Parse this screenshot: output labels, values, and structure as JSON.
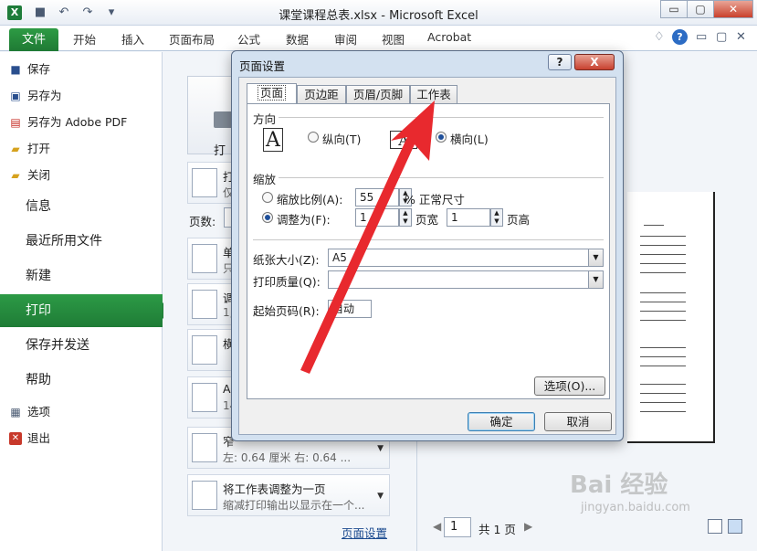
{
  "window": {
    "title": "课堂课程总表.xlsx - Microsoft Excel",
    "app_icon": "X",
    "minimize": "▭",
    "restore": "▢",
    "close": "✕"
  },
  "ribbon": {
    "file_tab": "文件",
    "tabs": [
      "开始",
      "插入",
      "页面布局",
      "公式",
      "数据",
      "审阅",
      "视图",
      "Acrobat"
    ],
    "help": "?"
  },
  "sidebar": {
    "small_items": [
      {
        "label": "保存",
        "icon": "save-icon"
      },
      {
        "label": "另存为",
        "icon": "save-as-icon"
      },
      {
        "label": "另存为 Adobe PDF",
        "icon": "pdf-icon"
      },
      {
        "label": "打开",
        "icon": "open-folder-icon"
      },
      {
        "label": "关闭",
        "icon": "close-folder-icon"
      }
    ],
    "big_items": [
      "信息",
      "最近所用文件",
      "新建",
      "打印",
      "保存并发送",
      "帮助"
    ],
    "bottom_items": [
      {
        "label": "选项",
        "icon": "options-icon"
      },
      {
        "label": "退出",
        "icon": "exit-icon"
      }
    ],
    "active": "打印"
  },
  "print_panel": {
    "print_button": "打印",
    "pages_label": "页数:",
    "options": [
      {
        "t1": "打",
        "t2": "仅"
      },
      {
        "t1": "单",
        "t2": "只"
      },
      {
        "t1": "调",
        "t2": "1,"
      },
      {
        "t1": "横",
        "t2": ""
      },
      {
        "t1": "A",
        "t2": "14"
      },
      {
        "t1": "窄",
        "t2": "左: 0.64 厘米    右: 0.64 ..."
      },
      {
        "t1": "将工作表调整为一页",
        "t2": "缩减打印输出以显示在一个..."
      }
    ],
    "page_setup_link": "页面设置"
  },
  "preview": {
    "current_page": "1",
    "total": "共 1 页",
    "watermark": "Bai 经验",
    "watermark_url": "jingyan.baidu.com"
  },
  "dialog": {
    "title": "页面设置",
    "help": "?",
    "close": "X",
    "tabs": [
      "页面",
      "页边距",
      "页眉/页脚",
      "工作表"
    ],
    "active_tab": "页面",
    "orientation": {
      "section": "方向",
      "portrait": "纵向(T)",
      "landscape": "横向(L)",
      "selected": "landscape"
    },
    "scaling": {
      "section": "缩放",
      "adjust_label": "缩放比例(A):",
      "adjust_value": "55",
      "adjust_unit": "% 正常尺寸",
      "fit_label": "调整为(F):",
      "fit_wide": "1",
      "fit_wide_unit": "页宽",
      "fit_tall": "1",
      "fit_tall_unit": "页高",
      "selected": "fit"
    },
    "paper_size_label": "纸张大小(Z):",
    "paper_size_value": "A5",
    "print_quality_label": "打印质量(Q):",
    "print_quality_value": "",
    "first_page_label": "起始页码(R):",
    "first_page_value": "自动",
    "options_button": "选项(O)...",
    "ok_button": "确定",
    "cancel_button": "取消"
  },
  "colors": {
    "accent_green": "#1f7c36",
    "annotation_arrow": "#e8292e"
  }
}
